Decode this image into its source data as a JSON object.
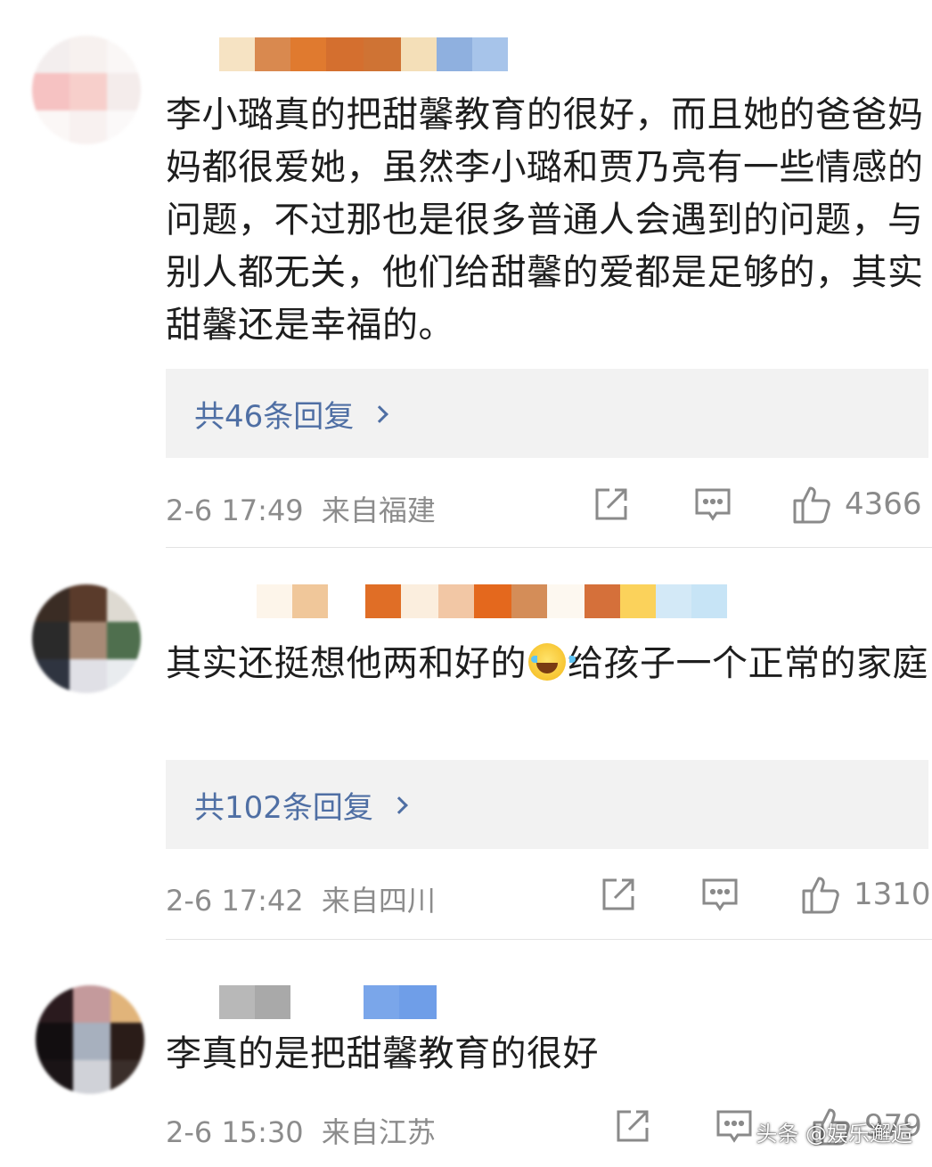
{
  "comments": [
    {
      "text": "李小璐真的把甜馨教育的很好，而且她的爸爸妈妈都很爱她，虽然李小璐和贾乃亮有一些情感的问题，不过那也是很多普通人会遇到的问题，与别人都无关，他们给甜馨的爱都是足够的，其实甜馨还是幸福的。",
      "replies_label": "共46条回复",
      "time": "2-6 17:49",
      "location": "来自福建",
      "likes": "4366"
    },
    {
      "text_before_emoji": "其实还挺想他两和好的",
      "emoji": "laugh-cry-emoji",
      "text_after_emoji": "给孩子一个正常的家庭",
      "replies_label": "共102条回复",
      "time": "2-6 17:42",
      "location": "来自四川",
      "likes": "1310"
    },
    {
      "text": "李真的是把甜馨教育的很好",
      "time": "2-6 15:30",
      "location": "来自江苏",
      "likes": "979"
    }
  ],
  "icons": {
    "share": "share-icon",
    "comment": "comment-icon",
    "like": "thumbs-up-icon"
  },
  "colors": {
    "reply_link": "#4f6fa4",
    "reply_bg": "#f2f2f2",
    "meta_text": "#8c8c8c"
  },
  "watermark": "头条 @娱乐邂逅"
}
